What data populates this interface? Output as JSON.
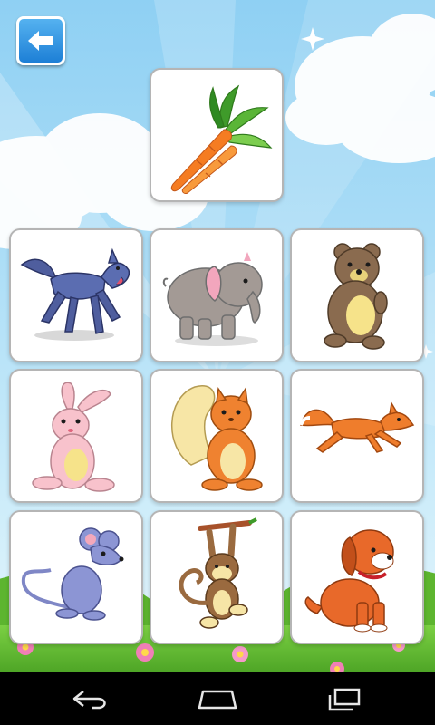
{
  "colors": {
    "sky_top": "#8fd0f3",
    "button_blue": "#1d7fd6",
    "card_border": "#b5b5b5",
    "grass": "#6cc23a",
    "navbar": "#000000"
  },
  "target": {
    "icon": "carrot-icon"
  },
  "grid": {
    "rows": [
      [
        {
          "icon": "wolf-icon"
        },
        {
          "icon": "elephant-icon"
        },
        {
          "icon": "bear-icon"
        }
      ],
      [
        {
          "icon": "rabbit-icon"
        },
        {
          "icon": "squirrel-icon"
        },
        {
          "icon": "fox-icon"
        }
      ],
      [
        {
          "icon": "mouse-icon"
        },
        {
          "icon": "monkey-icon"
        },
        {
          "icon": "puppy-icon"
        }
      ]
    ]
  },
  "navbar": {
    "back": {
      "icon": "nav-back-icon"
    },
    "home": {
      "icon": "nav-home-icon"
    },
    "recents": {
      "icon": "nav-recents-icon"
    }
  }
}
